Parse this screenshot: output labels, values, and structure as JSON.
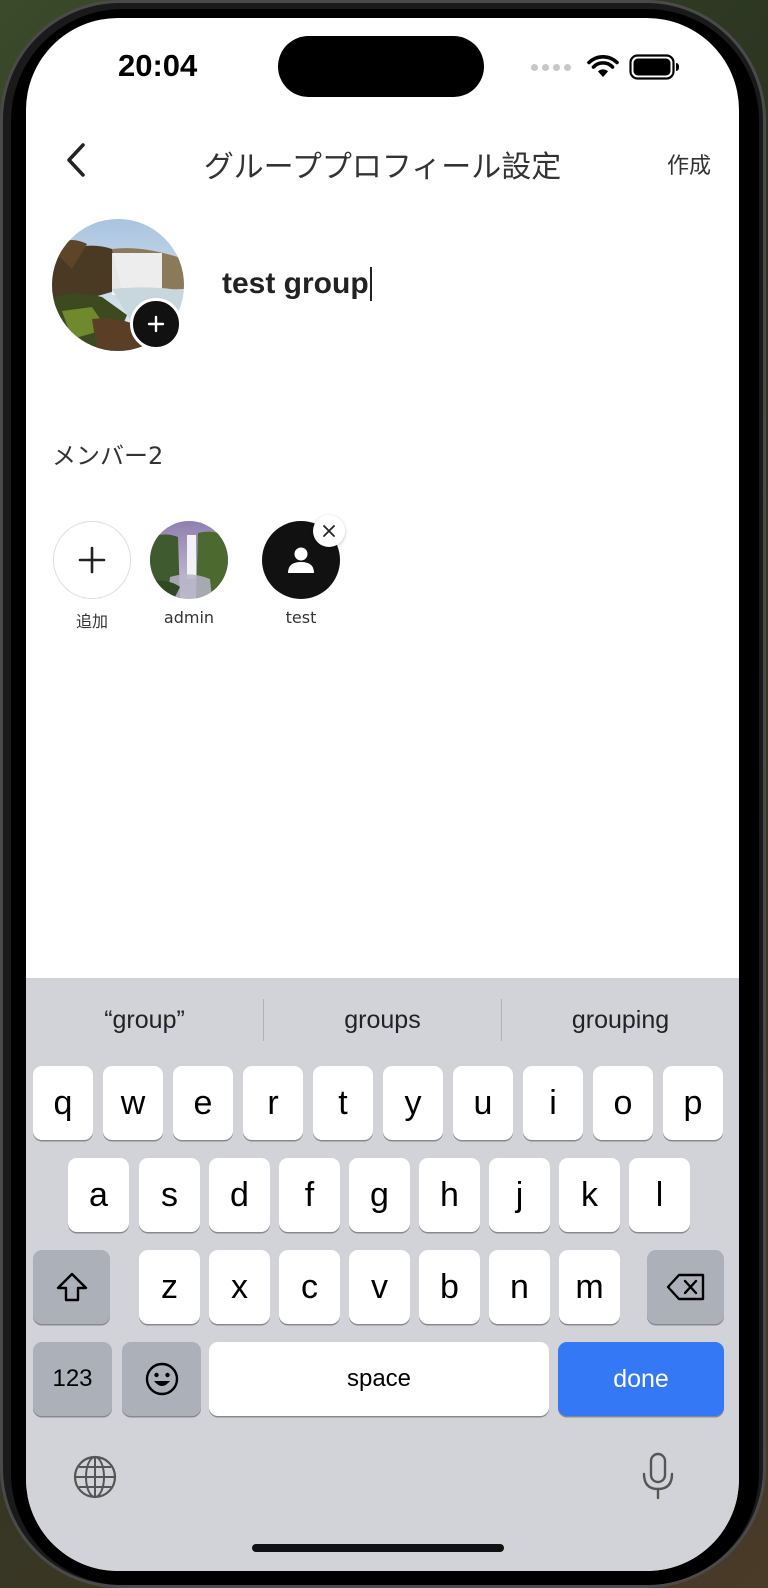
{
  "status_bar": {
    "time": "20:04"
  },
  "nav": {
    "title": "グループプロフィール設定",
    "create_label": "作成"
  },
  "group": {
    "name_value": "test group"
  },
  "members": {
    "heading": "メンバー2",
    "items": [
      {
        "label": "追加",
        "kind": "add"
      },
      {
        "label": "admin",
        "kind": "photo"
      },
      {
        "label": "test",
        "kind": "default-avatar",
        "removable": true
      }
    ]
  },
  "keyboard": {
    "suggestions": [
      "“group”",
      "groups",
      "grouping"
    ],
    "row1": [
      "q",
      "w",
      "e",
      "r",
      "t",
      "y",
      "u",
      "i",
      "o",
      "p"
    ],
    "row2": [
      "a",
      "s",
      "d",
      "f",
      "g",
      "h",
      "j",
      "k",
      "l"
    ],
    "row3": [
      "z",
      "x",
      "c",
      "v",
      "b",
      "n",
      "m"
    ],
    "numbers_label": "123",
    "space_label": "space",
    "done_label": "done"
  },
  "colors": {
    "done_key": "#3478f6",
    "keyboard_bg": "#d1d3d9",
    "avatar_dark": "#111111"
  }
}
